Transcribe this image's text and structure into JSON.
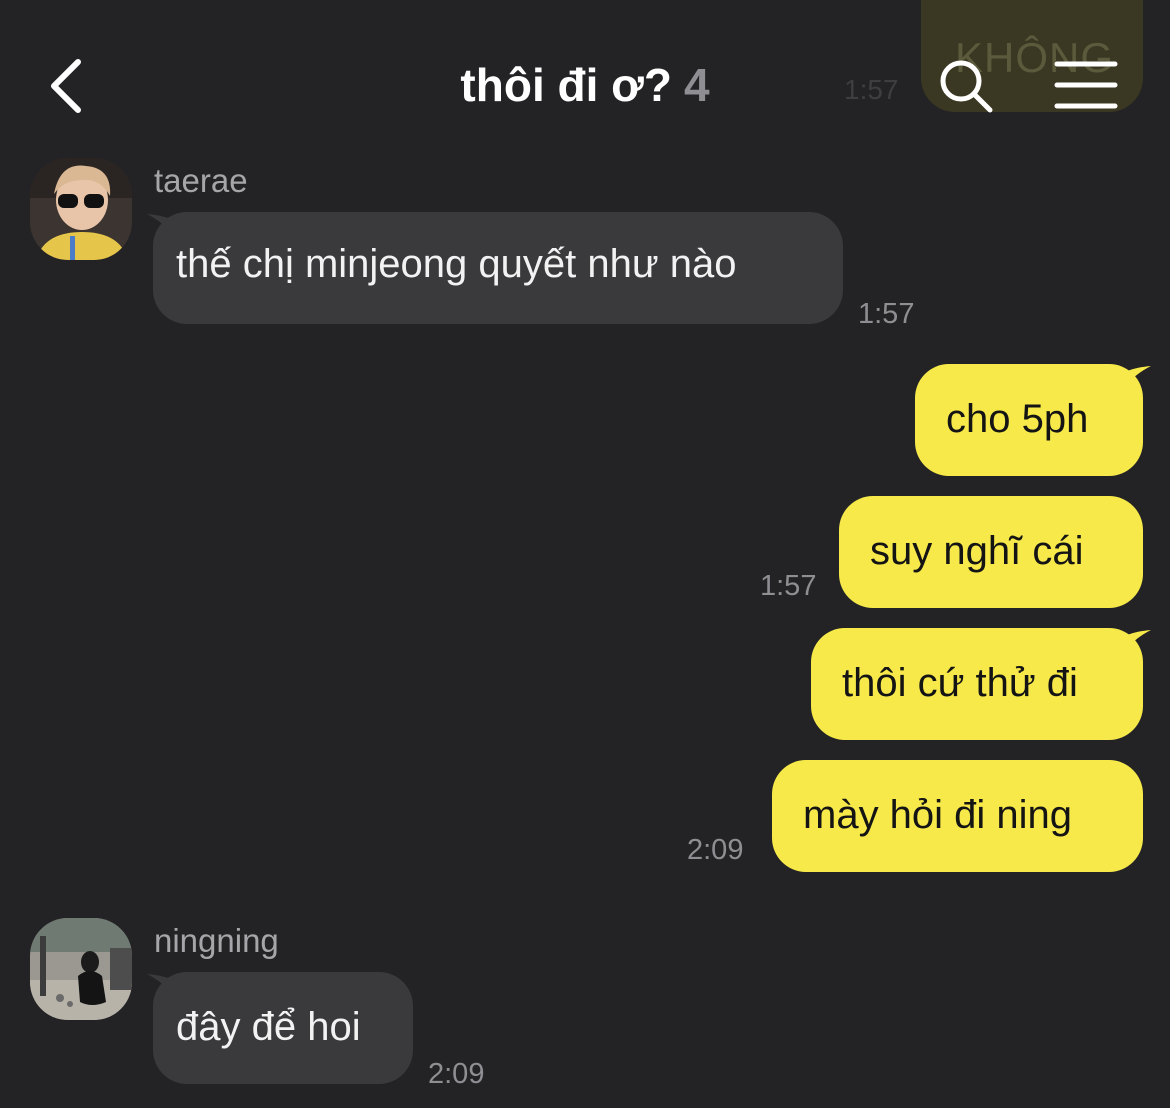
{
  "header": {
    "title": "thôi đi ơ?",
    "member_count": "4"
  },
  "ghost_message": {
    "text": "KHÔNG",
    "time": "1:57"
  },
  "messages": [
    {
      "sender": "taerae",
      "text": "thế chị minjeong quyết như nào",
      "time": "1:57"
    },
    {
      "text": "cho 5ph"
    },
    {
      "text": "suy nghĩ cái",
      "time": "1:57"
    },
    {
      "text": "thôi cứ thử đi"
    },
    {
      "text": "mày hỏi đi ning",
      "time": "2:09"
    },
    {
      "sender": "ningning",
      "text": "đây để hoi",
      "time": "2:09"
    }
  ],
  "colors": {
    "background": "#232325",
    "incoming_bubble": "#3a3a3c",
    "outgoing_bubble": "#f7e94a",
    "timestamp": "#8e8e93"
  }
}
